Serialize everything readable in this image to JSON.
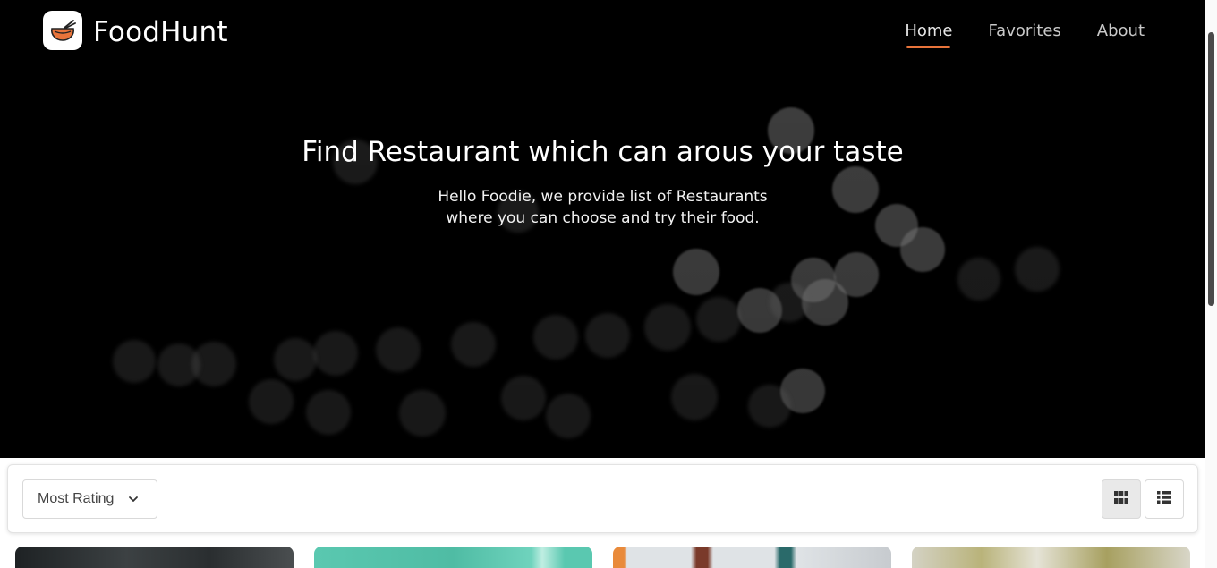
{
  "brand": {
    "name": "FoodHunt",
    "logo_icon": "noodle-bowl-icon",
    "accent": "#e8743b"
  },
  "nav": {
    "items": [
      {
        "label": "Home",
        "active": true
      },
      {
        "label": "Favorites",
        "active": false
      },
      {
        "label": "About",
        "active": false
      }
    ]
  },
  "hero": {
    "title": "Find Restaurant which can arous your taste",
    "subtitle": "Hello Foodie, we provide list of Restaurants where you can choose and try their food."
  },
  "filter": {
    "sort_value": "Most Rating",
    "sort_icon": "chevron-down-icon",
    "view_grid_icon": "grid-view-icon",
    "view_list_icon": "list-view-icon",
    "active_view": "grid"
  },
  "cards": [
    {
      "image": "restaurant-photo-1",
      "tone": "#2d3133"
    },
    {
      "image": "restaurant-photo-2",
      "tone": "#55c4ab"
    },
    {
      "image": "restaurant-photo-3",
      "tone": "#d9dde0"
    },
    {
      "image": "restaurant-photo-4",
      "tone": "#c8c39a"
    }
  ]
}
